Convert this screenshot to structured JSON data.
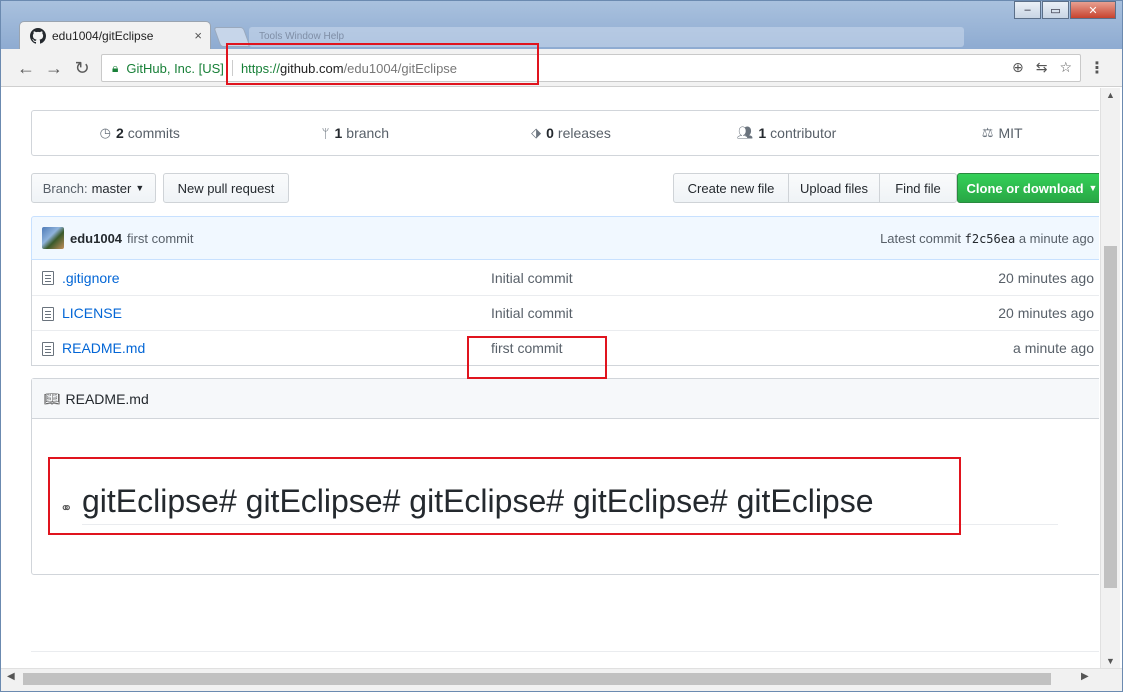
{
  "browser": {
    "tab_title": "edu1004/gitEclipse",
    "tab_close": "×",
    "ghost_menu": "Tools    Window    Help",
    "secure_label": "GitHub, Inc. [US]",
    "url_scheme": "https://",
    "url_host": "github.com",
    "url_path": "/edu1004/gitEclipse",
    "window_controls": {
      "minimize": "‒",
      "maximize": "▭",
      "close": "✕"
    }
  },
  "repo": {
    "numbers": [
      {
        "icon": "history-icon",
        "count": "2",
        "label": "commits"
      },
      {
        "icon": "branch-icon",
        "count": "1",
        "label": "branch"
      },
      {
        "icon": "tag-icon",
        "count": "0",
        "label": "releases"
      },
      {
        "icon": "people-icon",
        "count": "1",
        "label": "contributor"
      },
      {
        "icon": "law-icon",
        "count": "",
        "label": "MIT"
      }
    ],
    "branch_prefix": "Branch:",
    "branch_name": "master",
    "new_pr": "New pull request",
    "create_file": "Create new file",
    "upload_files": "Upload files",
    "find_file": "Find file",
    "clone": "Clone or download",
    "commit": {
      "author": "edu1004",
      "message": "first commit",
      "latest_label": "Latest commit",
      "sha": "f2c56ea",
      "age": "a minute ago"
    },
    "files": [
      {
        "name": ".gitignore",
        "commit": "Initial commit",
        "age": "20 minutes ago"
      },
      {
        "name": "LICENSE",
        "commit": "Initial commit",
        "age": "20 minutes ago"
      },
      {
        "name": "README.md",
        "commit": "first commit",
        "age": "a minute ago"
      }
    ],
    "readme": {
      "title": "README.md",
      "heading": "gitEclipse# gitEclipse# gitEclipse# gitEclipse# gitEclipse"
    }
  },
  "colors": {
    "highlight": "#e0141e",
    "link": "#0366d6",
    "clone_green": "#28a745"
  }
}
